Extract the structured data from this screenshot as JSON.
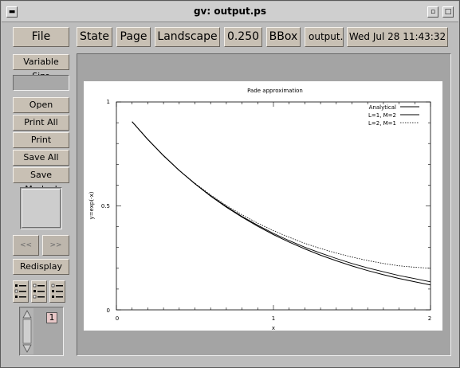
{
  "window": {
    "title": "gv: output.ps"
  },
  "toolbar": {
    "file": "File",
    "state": "State",
    "page": "Page",
    "orientation": "Landscape",
    "zoom": "0.250",
    "bbox": "BBox",
    "filename": "output.ps",
    "date": "Wed Jul 28 11:43:32"
  },
  "sidebar": {
    "variable_size": "Variable Size",
    "open": "Open",
    "print_all": "Print All",
    "print_marked": "Print Marked",
    "save_all": "Save All",
    "save_marked": "Save Marked",
    "prev": "<<",
    "next": ">>",
    "redisplay": "Redisplay",
    "page_number": "1"
  },
  "chart_data": {
    "type": "line",
    "title": "Pade approximation",
    "xlabel": "x",
    "ylabel": "y=exp(-x)",
    "xlim": [
      0,
      2
    ],
    "ylim": [
      0,
      1
    ],
    "xticks": [
      "0",
      "1",
      "2"
    ],
    "yticks": [
      "0",
      "0.5",
      "1"
    ],
    "grid": false,
    "legend_position": "top-right",
    "x": [
      0.1,
      0.2,
      0.3,
      0.4,
      0.5,
      0.6,
      0.7,
      0.8,
      0.9,
      1.0,
      1.1,
      1.2,
      1.3,
      1.4,
      1.5,
      1.6,
      1.7,
      1.8,
      1.9,
      2.0
    ],
    "series": [
      {
        "name": "Analytical",
        "style": "solid",
        "values": [
          0.905,
          0.819,
          0.741,
          0.67,
          0.607,
          0.549,
          0.497,
          0.449,
          0.407,
          0.368,
          0.333,
          0.301,
          0.273,
          0.247,
          0.223,
          0.202,
          0.183,
          0.165,
          0.15,
          0.135
        ]
      },
      {
        "name": "L=1, M=2",
        "style": "solid",
        "values": [
          0.905,
          0.82,
          0.742,
          0.671,
          0.606,
          0.547,
          0.494,
          0.446,
          0.402,
          0.362,
          0.326,
          0.293,
          0.263,
          0.236,
          0.211,
          0.189,
          0.169,
          0.151,
          0.135,
          0.12
        ]
      },
      {
        "name": "L=2, M=1",
        "style": "dotted",
        "values": [
          0.905,
          0.819,
          0.741,
          0.671,
          0.609,
          0.553,
          0.502,
          0.457,
          0.417,
          0.381,
          0.349,
          0.32,
          0.295,
          0.273,
          0.254,
          0.237,
          0.223,
          0.212,
          0.205,
          0.2
        ]
      }
    ]
  }
}
